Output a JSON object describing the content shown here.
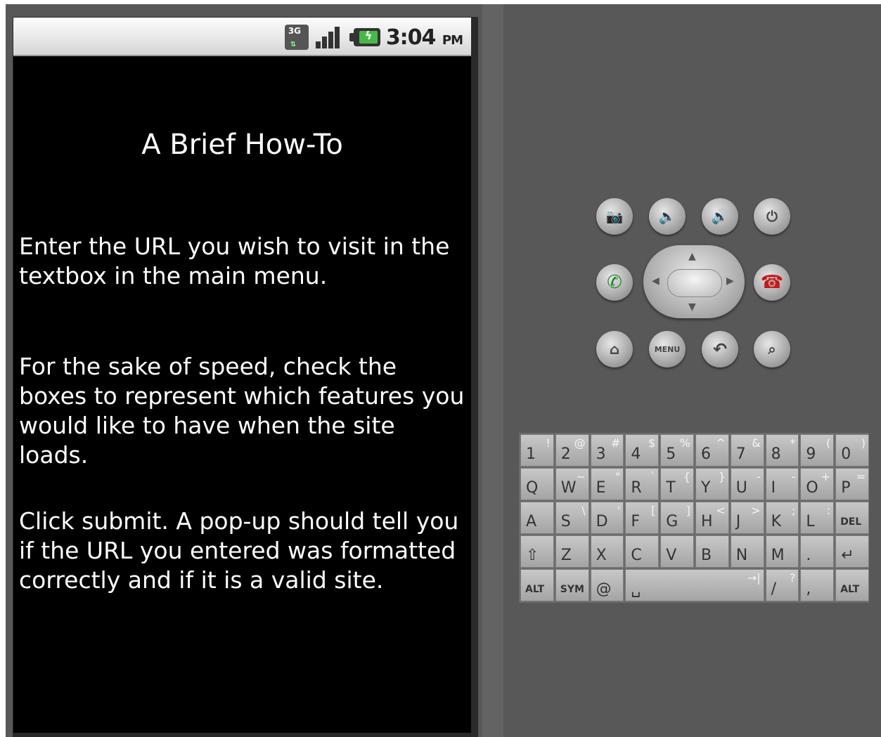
{
  "status_bar": {
    "network": "3G",
    "time": "3:04",
    "ampm": "PM"
  },
  "content": {
    "title": "A Brief How-To",
    "paragraphs": [
      "Enter the URL you wish to visit in the textbox in the main menu.",
      "For the sake of speed, check the boxes to represent which features you would like to have when the site loads.",
      "Click submit. A pop-up should tell you if the URL you entered was formatted correctly and if it is a valid site."
    ]
  },
  "controls": {
    "menu_label": "MENU",
    "icons": [
      "camera-icon",
      "volume-down-icon",
      "volume-up-icon",
      "power-icon",
      "call-icon",
      "end-call-icon",
      "home-icon",
      "back-icon",
      "search-icon"
    ]
  },
  "keyboard": {
    "row1": [
      [
        "1",
        "!"
      ],
      [
        "2",
        "@"
      ],
      [
        "3",
        "#"
      ],
      [
        "4",
        "$"
      ],
      [
        "5",
        "%"
      ],
      [
        "6",
        "^"
      ],
      [
        "7",
        "&"
      ],
      [
        "8",
        "*"
      ],
      [
        "9",
        "("
      ],
      [
        "0",
        ")"
      ]
    ],
    "row2": [
      [
        "Q",
        ""
      ],
      [
        "W",
        "~"
      ],
      [
        "E",
        "\""
      ],
      [
        "R",
        "`"
      ],
      [
        "T",
        "{"
      ],
      [
        "Y",
        "}"
      ],
      [
        "U",
        "-"
      ],
      [
        "I",
        "-"
      ],
      [
        "O",
        "+"
      ],
      [
        "P",
        "="
      ]
    ],
    "row3": [
      [
        "A",
        ""
      ],
      [
        "S",
        "\\"
      ],
      [
        "D",
        "'"
      ],
      [
        "F",
        "["
      ],
      [
        "G",
        "]"
      ],
      [
        "H",
        "<"
      ],
      [
        "J",
        ">"
      ],
      [
        "K",
        ";"
      ],
      [
        "L",
        ":"
      ],
      [
        "DEL",
        ""
      ]
    ],
    "row4": [
      [
        "⇧",
        ""
      ],
      [
        "Z",
        ""
      ],
      [
        "X",
        ""
      ],
      [
        "C",
        ""
      ],
      [
        "V",
        ""
      ],
      [
        "B",
        ""
      ],
      [
        "N",
        ""
      ],
      [
        "M",
        ""
      ],
      [
        ".",
        ""
      ],
      [
        "↵",
        ""
      ]
    ],
    "row5": {
      "alt_left": "ALT",
      "sym": "SYM",
      "at": "@",
      "space": "␣",
      "slash": "/",
      "slash_alt": "?",
      "comma": ",",
      "alt_right": "ALT"
    }
  }
}
